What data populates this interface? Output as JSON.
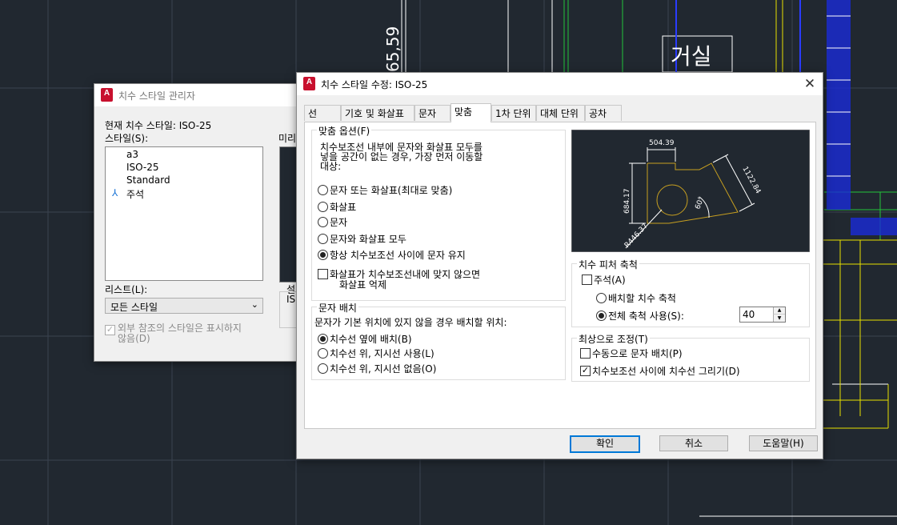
{
  "cad": {
    "room_label": "거실",
    "dimension_text": "65,59"
  },
  "manager": {
    "title": "치수 스타일 관리자",
    "current_style": "현재 치수 스타일: ISO-25",
    "styles_label": "스타일(S):",
    "styles": [
      "a3",
      "ISO-25",
      "Standard",
      "주석"
    ],
    "preview_label": "미리",
    "list_label": "리스트(L):",
    "list_value": "모든 스타일",
    "xref_line1": "외부 참조의 스타일은 표시하지",
    "xref_line2": "않음(D)",
    "desc_label": "설",
    "desc_value": "IS"
  },
  "modify": {
    "title": "치수 스타일 수정: ISO-25",
    "tabs": [
      "선",
      "기호 및 화살표",
      "문자",
      "맞춤",
      "1차 단위",
      "대체 단위",
      "공차"
    ],
    "fit_options": {
      "title": "맞춤 옵션(F)",
      "desc": [
        "치수보조선 내부에 문자와 화살표 모두를",
        "넣을 공간이 없는 경우, 가장 먼저 이동할",
        "대상:"
      ],
      "options": [
        "문자 또는 화살표(최대로 맞춤)",
        "화살표",
        "문자",
        "문자와 화살표 모두",
        "항상 치수보조선 사이에 문자 유지"
      ],
      "selected_index": 4,
      "suppress_line1": "화살표가 치수보조선내에 맞지 않으면",
      "suppress_line2": "화살표 억제"
    },
    "text_placement": {
      "title": "문자 배치",
      "desc": "문자가 기본 위치에 있지 않을 경우 배치할 위치:",
      "options": [
        "치수선 옆에 배치(B)",
        "치수선 위, 지시선 사용(L)",
        "치수선 위, 지시선 없음(O)"
      ],
      "selected_index": 0
    },
    "preview": {
      "dim_top": "504.39",
      "dim_left": "684.17",
      "dim_right": "1122.84",
      "dim_angle": "60°",
      "dim_radius": "R446.37"
    },
    "scale": {
      "title": "치수 피처 축척",
      "annotative": "주석(A)",
      "layout_scale": "배치할 치수 축척",
      "overall_scale": "전체 축척 사용(S):",
      "overall_value": "40",
      "selected": "overall"
    },
    "fine_tuning": {
      "title": "최상으로 조정(T)",
      "manual": "수동으로 문자 배치(P)",
      "draw_dim_line": "치수보조선 사이에 치수선 그리기(D)",
      "manual_checked": false,
      "draw_checked": true
    },
    "buttons": {
      "ok": "확인",
      "cancel": "취소",
      "help": "도움말(H)"
    }
  },
  "colors": {
    "cad_bg": "#212830",
    "accent": "#0078d7",
    "icon_red": "#c8102e"
  }
}
